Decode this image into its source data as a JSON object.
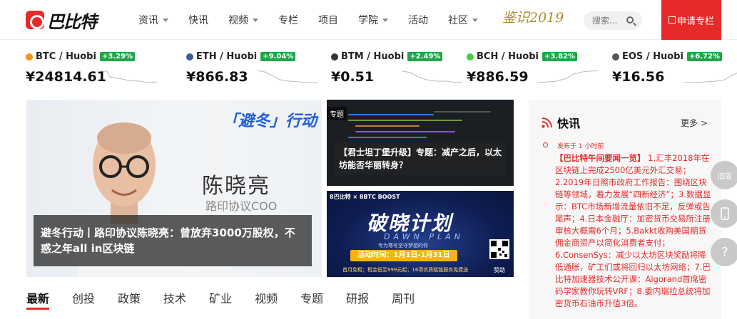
{
  "header": {
    "logo_text": "巴比特",
    "nav": [
      {
        "label": "资讯",
        "dropdown": true
      },
      {
        "label": "快讯",
        "dropdown": false
      },
      {
        "label": "视频",
        "dropdown": true
      },
      {
        "label": "专栏",
        "dropdown": false
      },
      {
        "label": "项目",
        "dropdown": false
      },
      {
        "label": "学院",
        "dropdown": true
      },
      {
        "label": "活动",
        "dropdown": false
      },
      {
        "label": "社区",
        "dropdown": true
      }
    ],
    "brand_script": "鉴识2019",
    "search_placeholder": "搜索...",
    "apply_label": "申请专栏",
    "accent_color": "#e62a2a"
  },
  "ticker": [
    {
      "pair": "BTC / Huobi",
      "change": "+3.29%",
      "price": "¥24814.61",
      "icon_color": "#f7931a",
      "icon": "btc-icon"
    },
    {
      "pair": "ETH / Huobi",
      "change": "+9.04%",
      "price": "¥866.83",
      "icon_color": "#3c5a99",
      "icon": "eth-icon"
    },
    {
      "pair": "BTM / Huobi",
      "change": "+2.49%",
      "price": "¥0.51",
      "icon_color": "#333333",
      "icon": "btm-icon"
    },
    {
      "pair": "BCH / Huobi",
      "change": "+3.82%",
      "price": "¥886.59",
      "icon_color": "#4cc947",
      "icon": "bch-icon"
    },
    {
      "pair": "EOS / Huobi",
      "change": "+6.72%",
      "price": "¥16.56",
      "icon_color": "#555555",
      "icon": "eos-icon"
    }
  ],
  "hero": {
    "slogan": "「避冬」行动",
    "name": "陈晓亮",
    "title": "路印协议COO",
    "caption": "避冬行动丨路印协议陈晓亮：曾放弃3000万股权，不惑之年all in区块链"
  },
  "card1": {
    "tag": "专题",
    "caption": "【君士坦丁堡升级】专题：减产之后，以太坊能否华丽转身？"
  },
  "card2": {
    "logos": "8巴比特 × 8BTC BOOST",
    "title": "破晓计划",
    "subtitle": "DAWN PLAN",
    "tagline": "专为寒冬坚守梦想的你",
    "date": "活动时间：1月1日-1月31日",
    "footer": "首月免租；租金低至999元起；16项优质赋能服务免费送",
    "help": "赞助"
  },
  "tabs": [
    "最新",
    "创投",
    "政策",
    "技术",
    "矿业",
    "视频",
    "专题",
    "研报",
    "周刊"
  ],
  "news": {
    "title": "快讯",
    "more": "更多 >",
    "time": "发布于 1 小时前",
    "headline": "【巴比特午间要闻一览】",
    "body": "1.汇丰2018年在区块链上完成2500亿美元外汇交易；2.2019年日照市政府工作报告：围绕区块链等领域，着力发展“四新经济”；3.数据显示：BTC市场新增流量依旧不足，反弹或告尾声；4.日本金融厅：加密货币交易所注册审核大概需6个月；5.Bakkt收购美国期货佣金商资产以简化消费者支付；6.ConsenSys：减少以太坊区块奖励将降低通胀，矿工们或将回归以太坊网络；7.巴比特加速器技术公开课：Algorand首席密码学家教你玩转VRF；8.委内瑞拉总统将加密货币石油币升值3倍。"
  },
  "floating": [
    "旧版",
    "手机",
    "?"
  ]
}
